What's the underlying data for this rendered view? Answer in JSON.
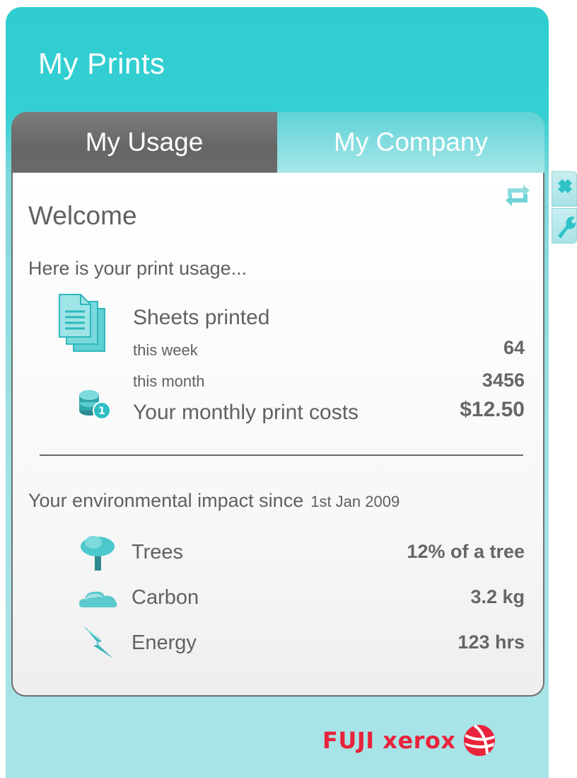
{
  "app": {
    "title": "My Prints"
  },
  "tabs": [
    {
      "label": "My Usage",
      "active": true
    },
    {
      "label": "My Company",
      "active": false
    }
  ],
  "usage": {
    "welcome": "Welcome",
    "intro": "Here is your print usage...",
    "sheets_label": "Sheets printed",
    "this_week_label": "this week",
    "this_week_value": "64",
    "this_month_label": "this month",
    "this_month_value": "3456",
    "cost_label": "Your monthly print costs",
    "cost_value": "$12.50"
  },
  "environment": {
    "label": "Your environmental impact since",
    "since_date": "1st Jan 2009",
    "items": [
      {
        "label": "Trees",
        "value": "12% of a tree",
        "icon": "tree-icon"
      },
      {
        "label": "Carbon",
        "value": "3.2 kg",
        "icon": "cloud-icon"
      },
      {
        "label": "Energy",
        "value": "123 hrs",
        "icon": "lightning-icon"
      }
    ]
  },
  "brand": {
    "name": "FUJI xerox"
  },
  "colors": {
    "accent": "#34cfd2",
    "active_tab": "#6e6e6e",
    "brand_red": "#e8233b"
  }
}
